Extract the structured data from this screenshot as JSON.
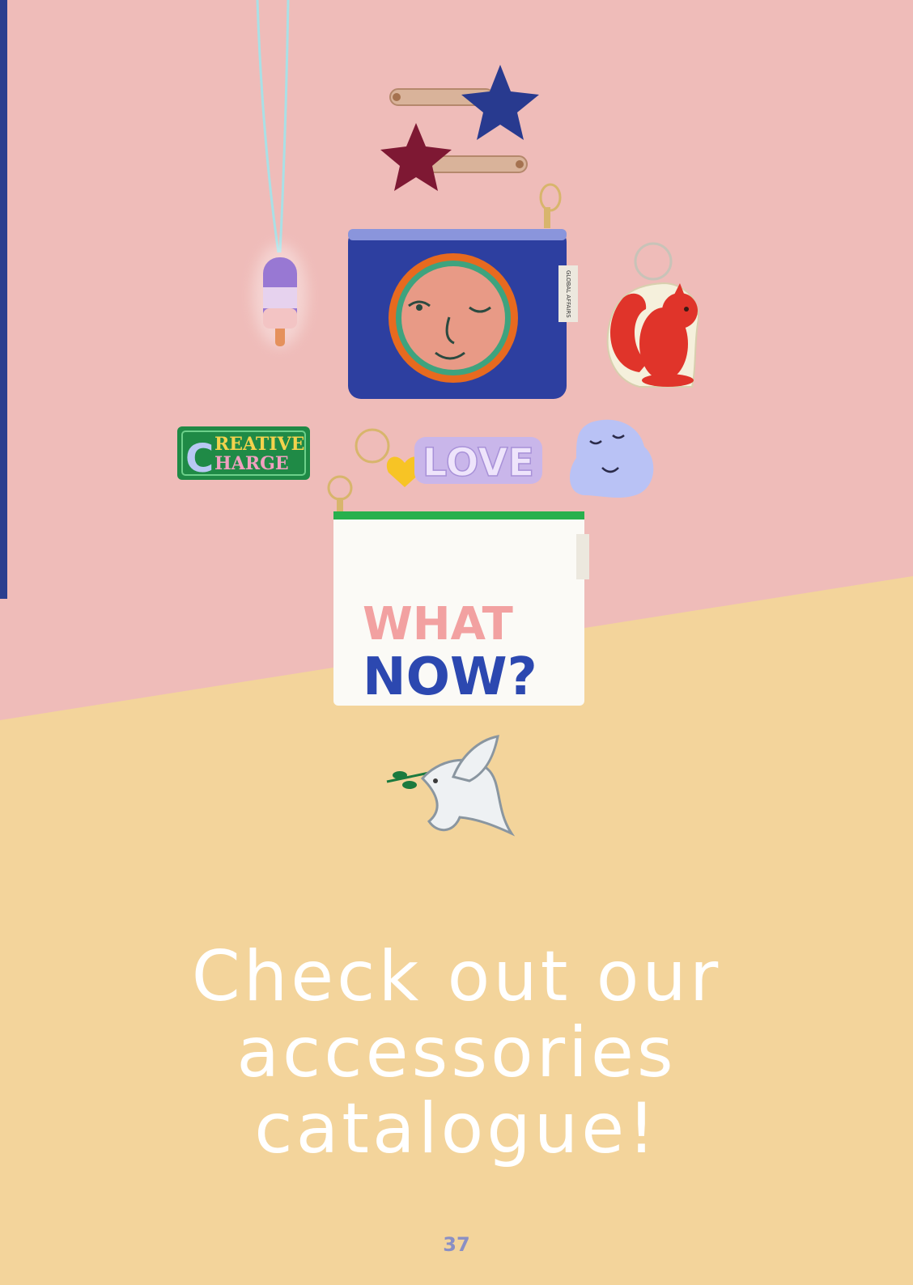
{
  "colors": {
    "pink_bg": "#efbcb9",
    "yellow_bg": "#f3d49b",
    "left_strip": "#2a3f8f",
    "navy_star": "#283a8f",
    "burgundy_star": "#7e1833",
    "pouch_blue": "#2d3fa0",
    "squirrel_red": "#e0342a",
    "patch_green": "#1f8a46",
    "love_lilac": "#c9b6ea",
    "cloud_lavender": "#b9c2f5",
    "dove_white": "#eef1f3",
    "page_number": "#8a8fc4"
  },
  "products": {
    "creative_patch": {
      "line1": "REATIVE",
      "line2": "HARGE",
      "initial": "C"
    },
    "love_keyring": "LOVE",
    "pouch_white": {
      "line1": "WHAT",
      "line2": "NOW?"
    },
    "pouch_label": "GLOBAL AFFAIRS"
  },
  "headline": {
    "line1": "Check out our",
    "line2": "accessories",
    "line3": "catalogue!"
  },
  "page_number": "37"
}
